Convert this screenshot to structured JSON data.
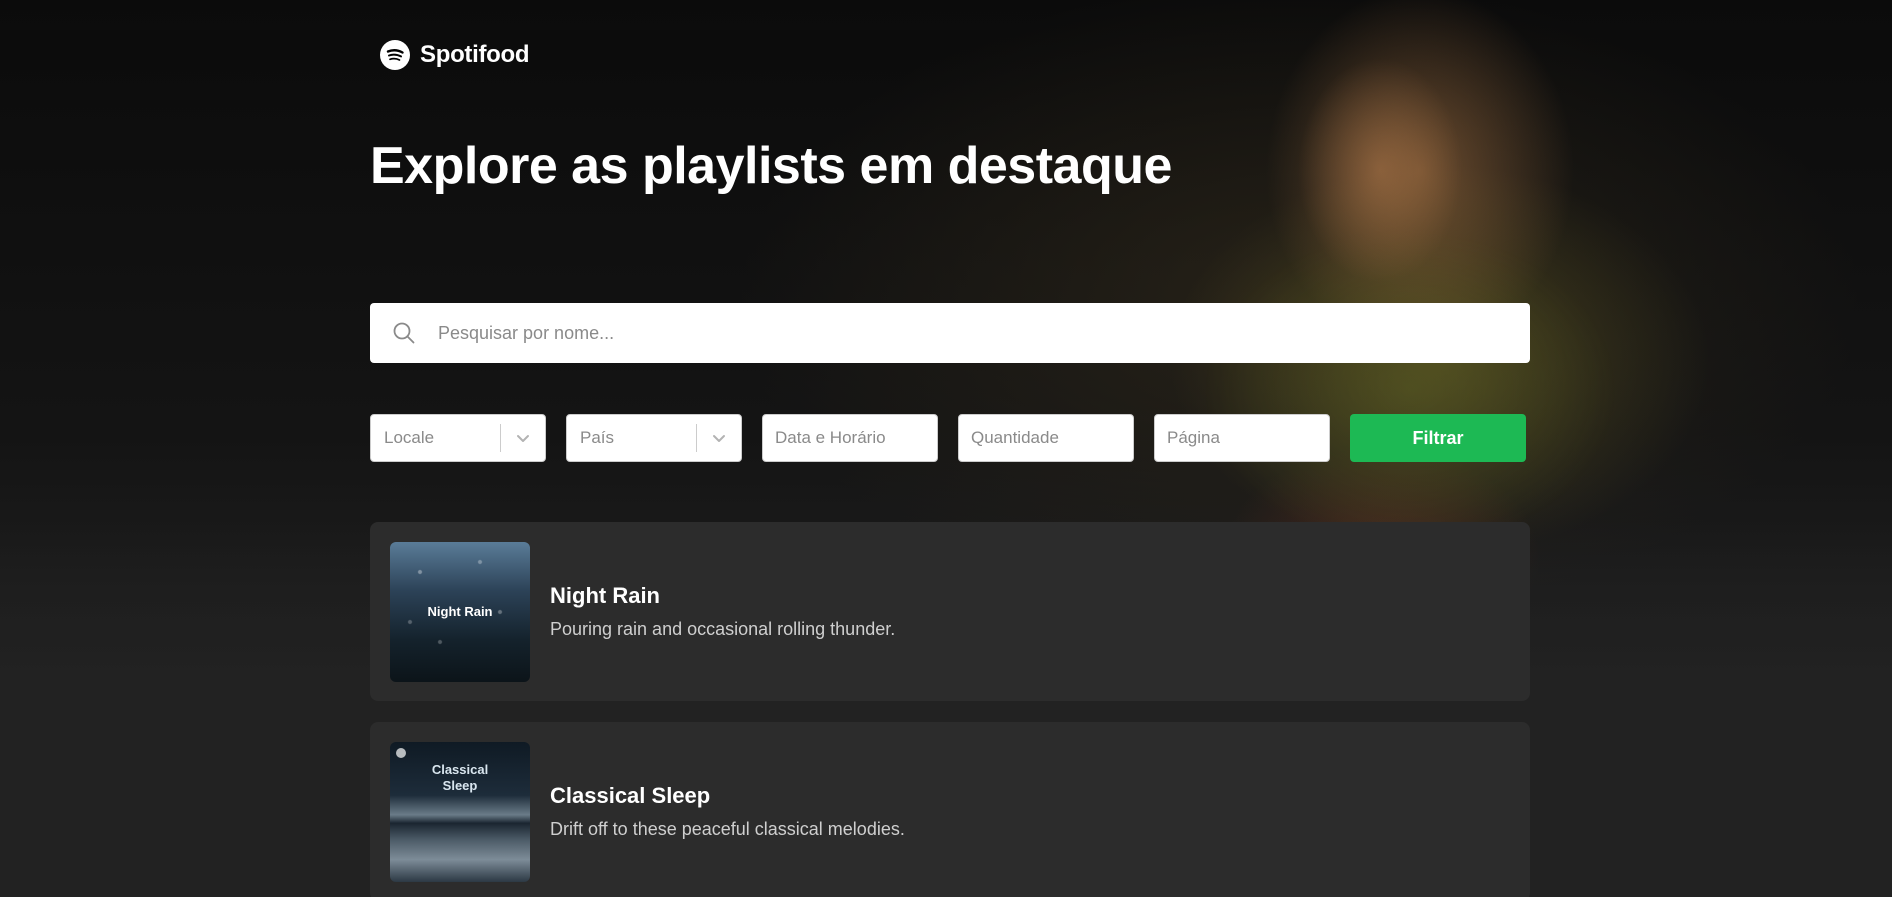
{
  "brand": {
    "name": "Spotifood",
    "logo_icon": "spotify-logo-icon",
    "accent_color": "#1db954"
  },
  "hero": {
    "title": "Explore as playlists em destaque"
  },
  "search": {
    "placeholder": "Pesquisar por nome...",
    "icon": "search-icon"
  },
  "filters": {
    "locale_placeholder": "Locale",
    "country_placeholder": "País",
    "datetime_placeholder": "Data e Horário",
    "quantity_placeholder": "Quantidade",
    "page_placeholder": "Página",
    "submit_label": "Filtrar"
  },
  "playlists": [
    {
      "name": "Night Rain",
      "cover_text": "Night Rain",
      "description": "Pouring rain and occasional rolling thunder."
    },
    {
      "name": "Classical Sleep",
      "cover_text_line1": "Classical",
      "cover_text_line2": "Sleep",
      "description": "Drift off to these peaceful classical melodies."
    }
  ]
}
